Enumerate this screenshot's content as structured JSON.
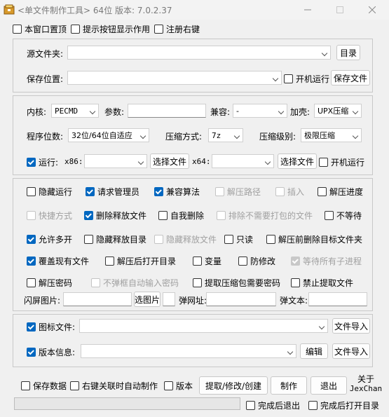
{
  "window": {
    "title": "<单文件制作工具> 64位 版本: 7.0.2.37",
    "minimize_icon": "minimize-icon",
    "maximize_icon": "maximize-icon",
    "close_icon": "close-icon"
  },
  "top_options": {
    "stay_on_top": "本窗口置顶",
    "show_tooltips": "提示按钮显示作用",
    "register_right_click": "注册右键"
  },
  "paths": {
    "source_label": "源文件夹:",
    "source_value": "",
    "dir_button": "目录",
    "save_label": "保存位置:",
    "save_value": "",
    "startup_run": "开机运行",
    "save_file_button": "保存文件"
  },
  "build": {
    "kernel_label": "内核:",
    "kernel_value": "PECMD",
    "param_label": "参数:",
    "param_value": "",
    "compat_label": "兼容:",
    "compat_value": "-",
    "shell_label": "加壳:",
    "shell_value": "UPX压缩",
    "bits_label": "程序位数:",
    "bits_value": "32位/64位自适应",
    "method_label": "压缩方式:",
    "method_value": "7z",
    "level_label": "压缩级别:",
    "level_value": "极限压缩",
    "run_label": "运行:",
    "run_checked": true,
    "x86_label": "x86:",
    "x86_value": "",
    "choose_file_1": "选择文件",
    "x64_label": "x64:",
    "x64_value": "",
    "choose_file_2": "选择文件",
    "startup_run": "开机运行"
  },
  "options": [
    [
      {
        "label": "隐藏运行",
        "checked": false,
        "disabled": false
      },
      {
        "label": "请求管理员",
        "checked": true,
        "disabled": false
      },
      {
        "label": "兼容算法",
        "checked": true,
        "disabled": false
      },
      {
        "label": "解压路径",
        "checked": false,
        "disabled": true
      },
      {
        "label": "插入",
        "checked": false,
        "disabled": true
      },
      {
        "label": "解压进度",
        "checked": false,
        "disabled": false
      }
    ],
    [
      {
        "label": "快捷方式",
        "checked": false,
        "disabled": true
      },
      {
        "label": "删除释放文件",
        "checked": true,
        "disabled": false
      },
      {
        "label": "自我删除",
        "checked": false,
        "disabled": false
      },
      {
        "label": "排除不需要打包的文件",
        "checked": false,
        "disabled": true
      },
      {
        "label": "不等待",
        "checked": false,
        "disabled": false
      }
    ],
    [
      {
        "label": "允许多开",
        "checked": true,
        "disabled": false
      },
      {
        "label": "隐藏释放目录",
        "checked": false,
        "disabled": false
      },
      {
        "label": "隐藏释放文件",
        "checked": false,
        "disabled": true
      },
      {
        "label": "只读",
        "checked": false,
        "disabled": false
      },
      {
        "label": "解压前删除目标文件夹",
        "checked": false,
        "disabled": false
      }
    ],
    [
      {
        "label": "覆盖现有文件",
        "checked": true,
        "disabled": false
      },
      {
        "label": "解压后打开目录",
        "checked": false,
        "disabled": false
      },
      {
        "label": "变量",
        "checked": false,
        "disabled": false
      },
      {
        "label": "防修改",
        "checked": false,
        "disabled": false
      },
      {
        "label": "等待所有子进程",
        "checked": true,
        "disabled": true
      }
    ],
    [
      {
        "label": "解压密码",
        "checked": false,
        "disabled": false
      },
      {
        "label": "不弹框自动输入密码",
        "checked": false,
        "disabled": true
      },
      {
        "label": "提取压缩包需要密码",
        "checked": false,
        "disabled": false
      },
      {
        "label": "禁止提取文件",
        "checked": false,
        "disabled": false
      }
    ]
  ],
  "splash": {
    "image_label": "闪屏图片:",
    "image_value": "",
    "choose_image": "选图片",
    "small_value": "",
    "url_label": "弹网址:",
    "url_value": "",
    "text_label": "弹文本:",
    "text_value": ""
  },
  "resources": {
    "icon_label": "图标文件:",
    "icon_checked": true,
    "icon_value": "",
    "icon_import": "文件导入",
    "version_label": "版本信息:",
    "version_checked": true,
    "version_value": "",
    "edit_button": "编辑",
    "version_import": "文件导入"
  },
  "footer": {
    "save_data": "保存数据",
    "auto_make": "右键关联时自动制作",
    "version": "版本",
    "extract_button": "提取/修改/创建",
    "make_button": "制作",
    "exit_button": "退出",
    "about_line1": "关于",
    "about_line2": "JexChan",
    "exit_after": "完成后退出",
    "open_after": "完成后打开目录",
    "progress": 0
  }
}
